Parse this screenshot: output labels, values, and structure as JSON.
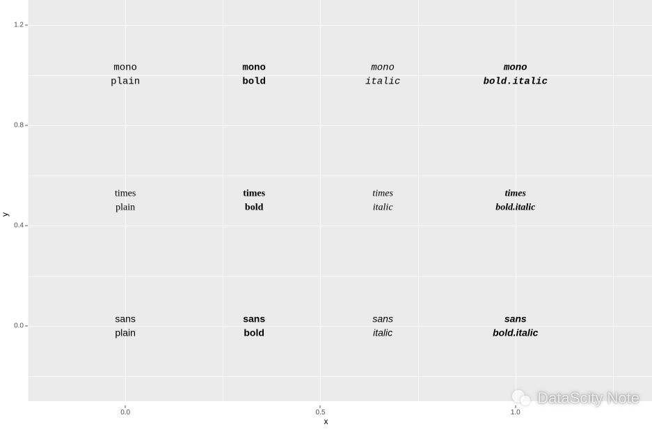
{
  "chart_data": {
    "type": "scatter",
    "xlabel": "x",
    "ylabel": "y",
    "xlim": [
      -0.25,
      1.35
    ],
    "ylim": [
      -0.3,
      1.3
    ],
    "x_ticks": [
      0.0,
      0.5,
      1.0
    ],
    "y_ticks": [
      0.0,
      0.4,
      0.8,
      1.2
    ],
    "x_minor_mid": [
      -0.25,
      0.25,
      0.75,
      1.25
    ],
    "y_minor_mid": [
      -0.2,
      0.2,
      0.6,
      1.0
    ],
    "points": [
      {
        "x": 0.0,
        "y": 0.0,
        "family": "sans",
        "face": "plain",
        "line1": "sans",
        "line2": "plain"
      },
      {
        "x": 0.33,
        "y": 0.0,
        "family": "sans",
        "face": "bold",
        "line1": "sans",
        "line2": "bold"
      },
      {
        "x": 0.66,
        "y": 0.0,
        "family": "sans",
        "face": "italic",
        "line1": "sans",
        "line2": "italic"
      },
      {
        "x": 1.0,
        "y": 0.0,
        "family": "sans",
        "face": "bold.italic",
        "line1": "sans",
        "line2": "bold.italic"
      },
      {
        "x": 0.0,
        "y": 0.5,
        "family": "times",
        "face": "plain",
        "line1": "times",
        "line2": "plain"
      },
      {
        "x": 0.33,
        "y": 0.5,
        "family": "times",
        "face": "bold",
        "line1": "times",
        "line2": "bold"
      },
      {
        "x": 0.66,
        "y": 0.5,
        "family": "times",
        "face": "italic",
        "line1": "times",
        "line2": "italic"
      },
      {
        "x": 1.0,
        "y": 0.5,
        "family": "times",
        "face": "bold.italic",
        "line1": "times",
        "line2": "bold.italic"
      },
      {
        "x": 0.0,
        "y": 1.0,
        "family": "mono",
        "face": "plain",
        "line1": "mono",
        "line2": "plain"
      },
      {
        "x": 0.33,
        "y": 1.0,
        "family": "mono",
        "face": "bold",
        "line1": "mono",
        "line2": "bold"
      },
      {
        "x": 0.66,
        "y": 1.0,
        "family": "mono",
        "face": "italic",
        "line1": "mono",
        "line2": "italic"
      },
      {
        "x": 1.0,
        "y": 1.0,
        "family": "mono",
        "face": "bold.italic",
        "line1": "mono",
        "line2": "bold.italic"
      }
    ]
  },
  "y_tick_labels": {
    "0": "0.0",
    "1": "0.4",
    "2": "0.8",
    "3": "1.2"
  },
  "x_tick_labels": {
    "0": "0.0",
    "1": "0.5",
    "2": "1.0"
  },
  "axes": {
    "x": "x",
    "y": "y"
  },
  "watermark": "DataScity Note"
}
